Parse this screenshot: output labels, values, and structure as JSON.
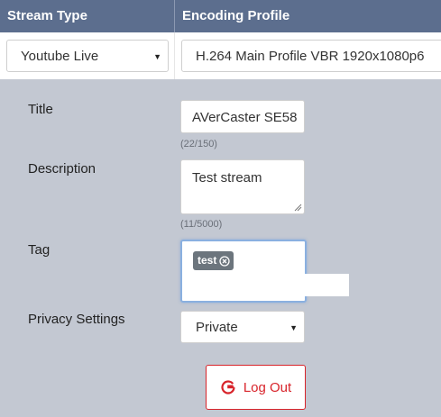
{
  "header": {
    "stream_type": "Stream Type",
    "encoding_profile": "Encoding Profile"
  },
  "selects": {
    "stream_type_value": "Youtube Live",
    "encoding_profile_value": "H.264 Main Profile VBR 1920x1080p6"
  },
  "form": {
    "title_label": "Title",
    "title_value": "AVerCaster SE58",
    "title_counter": "(22/150)",
    "description_label": "Description",
    "description_value": "Test stream",
    "description_counter": "(11/5000)",
    "tag_label": "Tag",
    "tags": [
      "test"
    ],
    "privacy_label": "Privacy Settings",
    "privacy_value": "Private"
  },
  "actions": {
    "logout_label": "Log Out"
  },
  "colors": {
    "header_bg": "#5c6e8e",
    "page_bg": "#c3c8d2",
    "logout_red": "#d8232a",
    "tag_chip_bg": "#6c757d"
  },
  "icons": {
    "select_caret": "caret-down-icon",
    "tag_remove": "close-circle-icon",
    "logout": "google-g-icon"
  }
}
